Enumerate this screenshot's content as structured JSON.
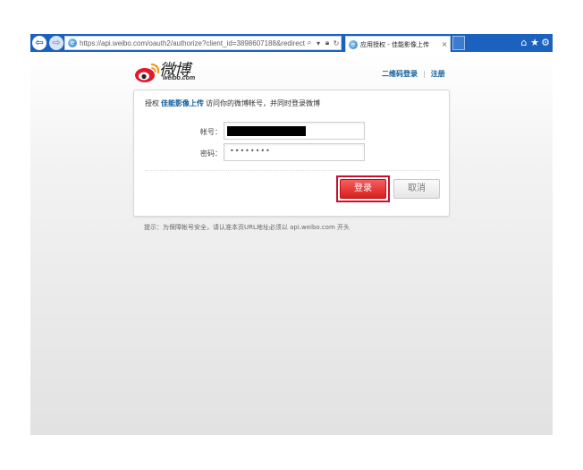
{
  "browser": {
    "url": "https://api.weibo.com/oauth2/authorize?client_id=3898607188&redirect_uri=",
    "tab_title": "应用授权 - 佳能影像上传",
    "tab_close": "×"
  },
  "logo": {
    "text": "微博",
    "subtext": "weibo.com"
  },
  "top_links": {
    "qr_login": "二维码登录",
    "separator": "|",
    "register": "注册"
  },
  "auth": {
    "prefix": "授权",
    "app_name": "佳能影像上传",
    "suffix": "访问你的微博帐号，并同时登录微博"
  },
  "form": {
    "account_label": "帐号：",
    "password_label": "密码：",
    "password_value": "••••••••"
  },
  "buttons": {
    "login": "登录",
    "cancel": "取消"
  },
  "tip": "提示：为保障帐号安全，请认准本页URL地址必须以 api.weibo.com 开头",
  "colors": {
    "browser_bar": "#1a62bd",
    "link": "#0f5d9b",
    "login_button": "#e02b2b",
    "highlight_ring": "#c8102e"
  },
  "icons": {
    "back": "back-arrow-icon",
    "forward": "forward-arrow-icon",
    "search": "search-icon",
    "lock": "lock-icon",
    "refresh": "refresh-icon",
    "home": "home-icon",
    "favorites": "star-icon",
    "settings": "gear-icon"
  }
}
